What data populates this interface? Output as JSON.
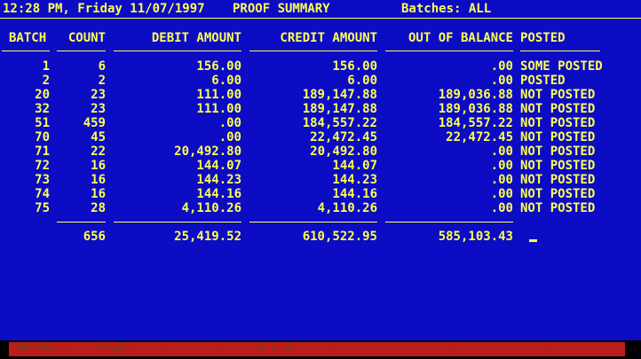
{
  "header": {
    "datetime": "12:28 PM, Friday 11/07/1997",
    "title": "PROOF SUMMARY",
    "batches_label": "Batches: ALL"
  },
  "columns": {
    "batch": "BATCH",
    "count": "COUNT",
    "debit": "DEBIT AMOUNT",
    "credit": "CREDIT AMOUNT",
    "oob": "OUT OF BALANCE",
    "posted": "POSTED"
  },
  "rows": [
    {
      "batch": "1",
      "count": "6",
      "debit": "156.00",
      "credit": "156.00",
      "oob": ".00",
      "posted": "SOME POSTED"
    },
    {
      "batch": "2",
      "count": "2",
      "debit": "6.00",
      "credit": "6.00",
      "oob": ".00",
      "posted": "POSTED"
    },
    {
      "batch": "20",
      "count": "23",
      "debit": "111.00",
      "credit": "189,147.88",
      "oob": "189,036.88",
      "posted": "NOT POSTED"
    },
    {
      "batch": "32",
      "count": "23",
      "debit": "111.00",
      "credit": "189,147.88",
      "oob": "189,036.88",
      "posted": "NOT POSTED"
    },
    {
      "batch": "51",
      "count": "459",
      "debit": ".00",
      "credit": "184,557.22",
      "oob": "184,557.22",
      "posted": "NOT POSTED"
    },
    {
      "batch": "70",
      "count": "45",
      "debit": ".00",
      "credit": "22,472.45",
      "oob": "22,472.45",
      "posted": "NOT POSTED"
    },
    {
      "batch": "71",
      "count": "22",
      "debit": "20,492.80",
      "credit": "20,492.80",
      "oob": ".00",
      "posted": "NOT POSTED"
    },
    {
      "batch": "72",
      "count": "16",
      "debit": "144.07",
      "credit": "144.07",
      "oob": ".00",
      "posted": "NOT POSTED"
    },
    {
      "batch": "73",
      "count": "16",
      "debit": "144.23",
      "credit": "144.23",
      "oob": ".00",
      "posted": "NOT POSTED"
    },
    {
      "batch": "74",
      "count": "16",
      "debit": "144.16",
      "credit": "144.16",
      "oob": ".00",
      "posted": "NOT POSTED"
    },
    {
      "batch": "75",
      "count": "28",
      "debit": "4,110.26",
      "credit": "4,110.26",
      "oob": ".00",
      "posted": "NOT POSTED"
    }
  ],
  "totals": {
    "count": "656",
    "debit": "25,419.52",
    "credit": "610,522.95",
    "oob": "585,103.43"
  },
  "status_bar": {
    "online": "ONLINE",
    "terminal": "tty01",
    "mode": "V T A",
    "separator": ":"
  },
  "colors": {
    "background": "#0c0cc4",
    "text": "#ffff54",
    "status_bar": "#bb1c1c"
  }
}
